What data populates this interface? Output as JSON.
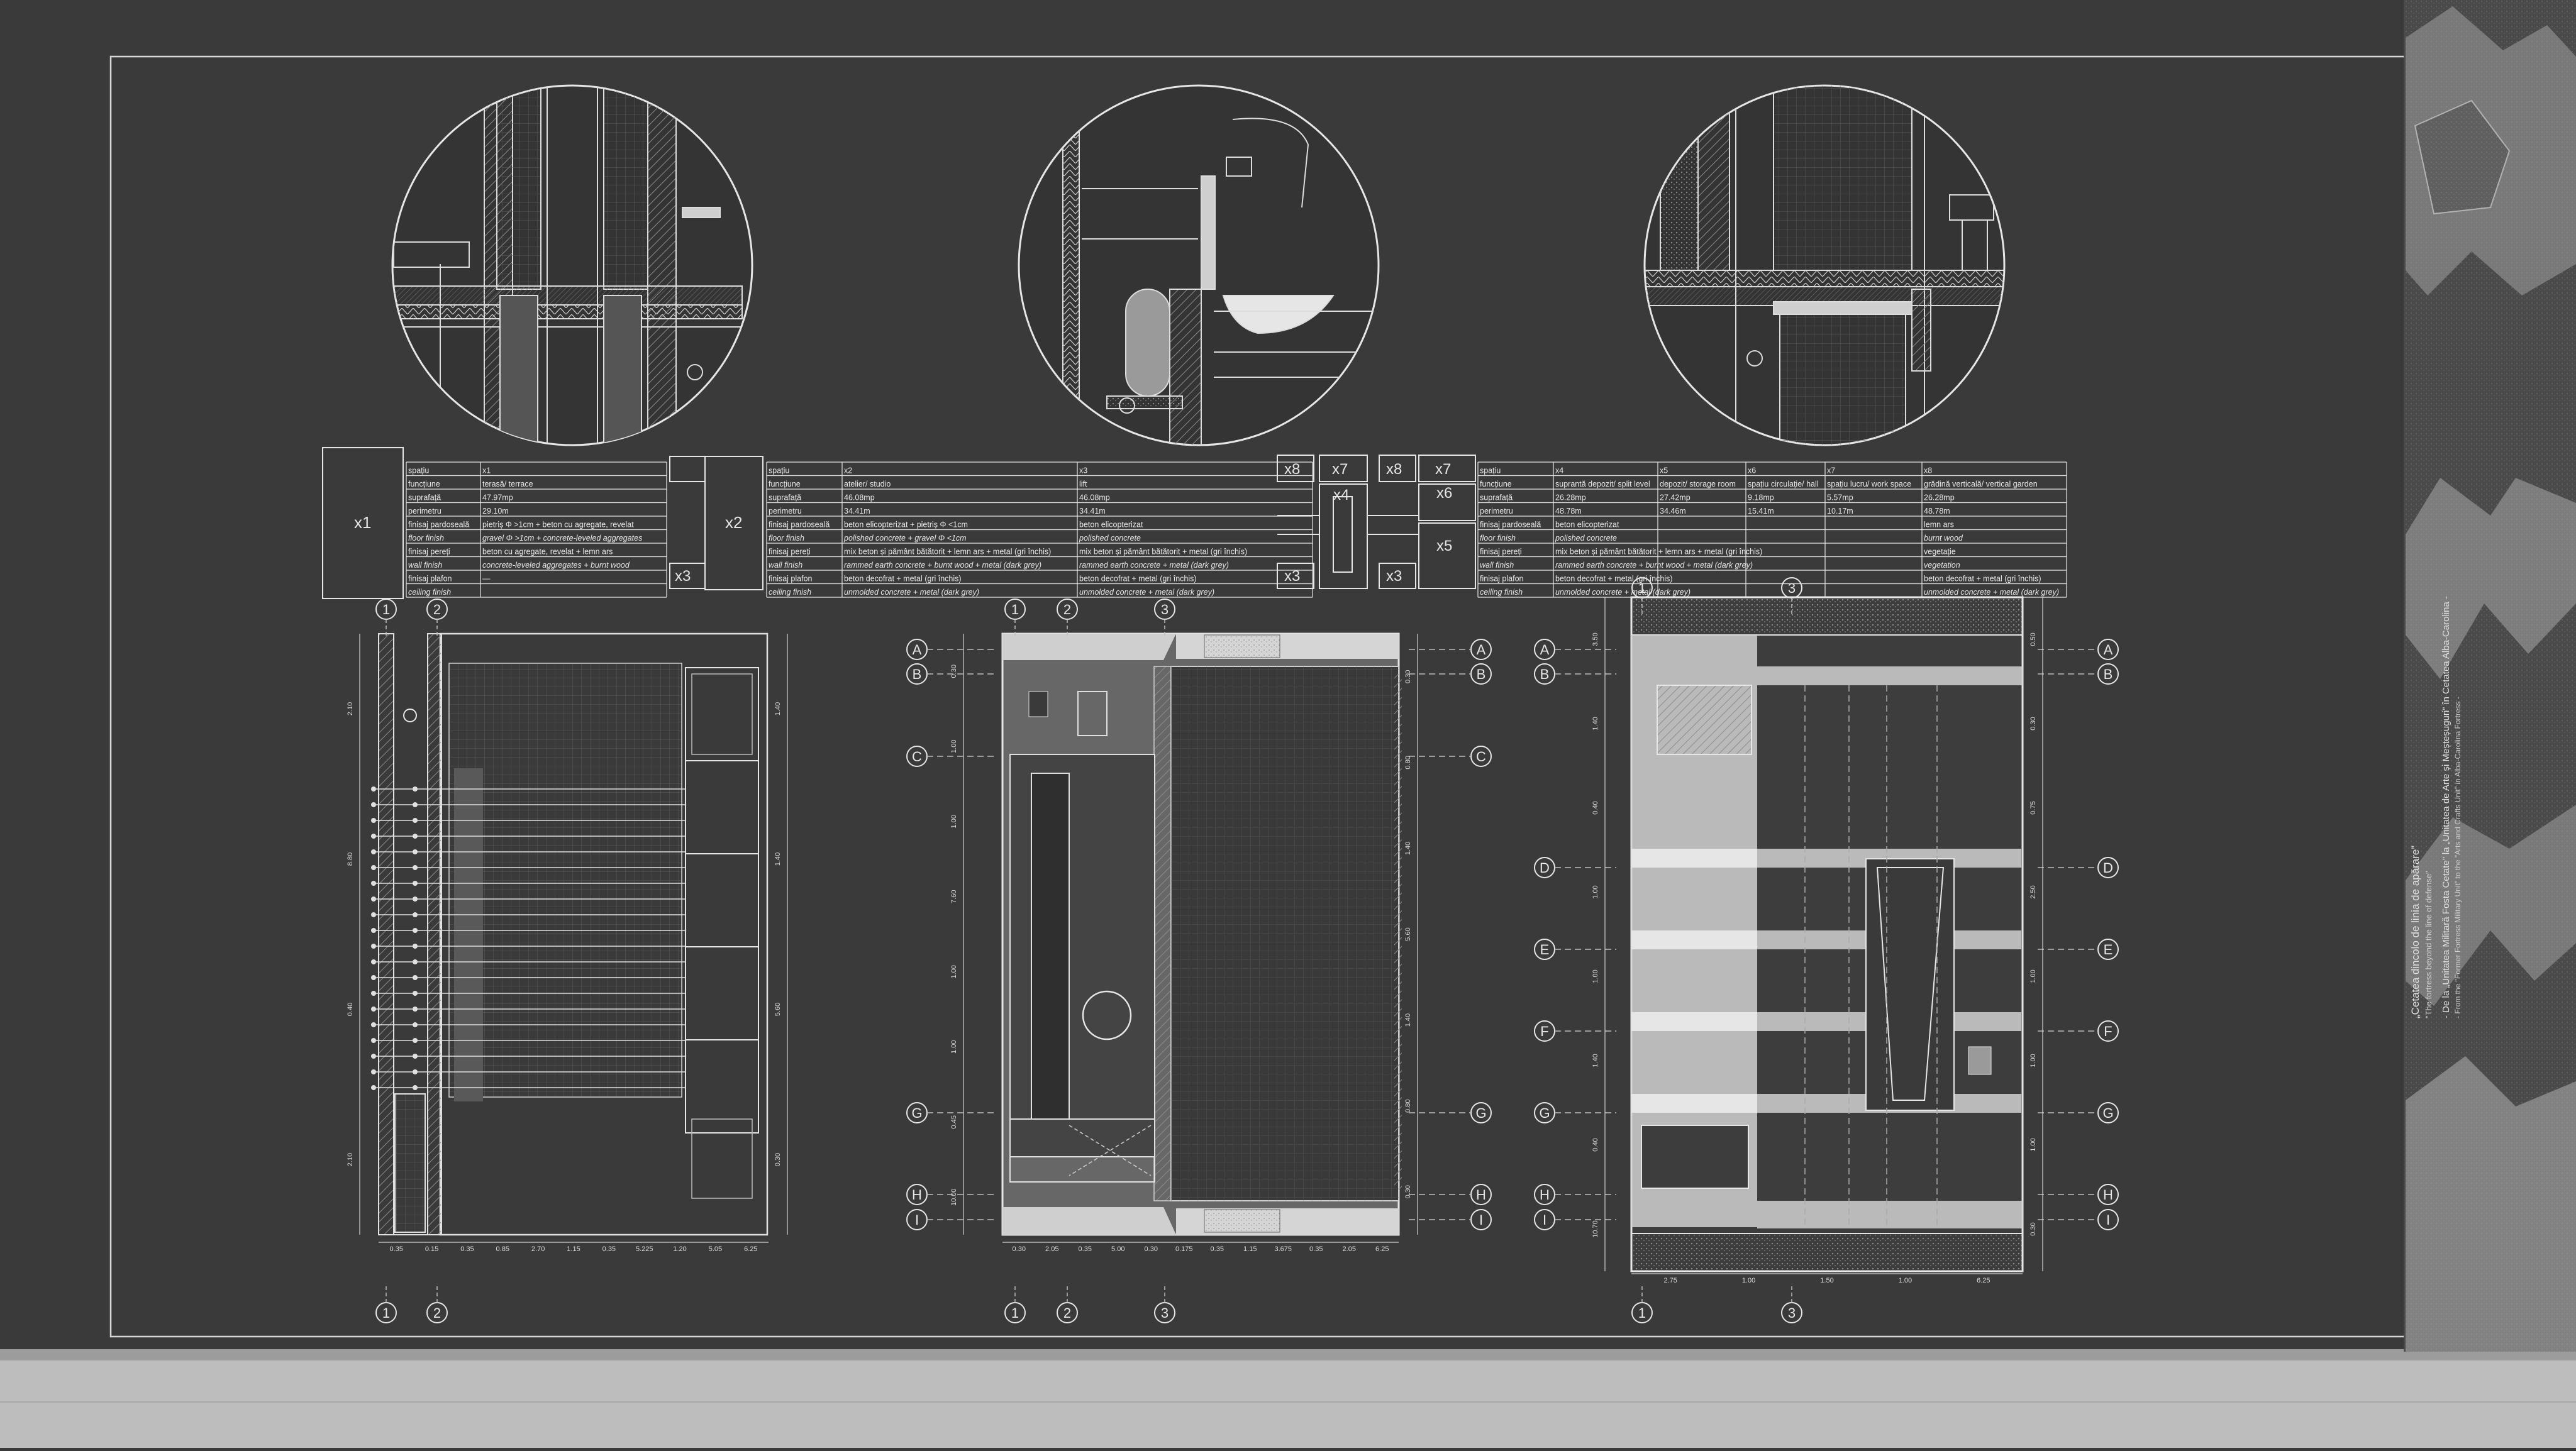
{
  "colors": {
    "background": "#3a3a3a",
    "line": "#e6e6e6",
    "hatch": "#8c8c8c",
    "floor": "#bdbdbd",
    "wall": "#cfcfcf"
  },
  "tables": {
    "left": {
      "label_a": "x1",
      "label_b": "x2",
      "label_b_small": "x3",
      "rows": [
        [
          "spațiu",
          "x1"
        ],
        [
          "funcțiune",
          "terasă/ terrace"
        ],
        [
          "suprafață",
          "47.97mp"
        ],
        [
          "perimetru",
          "29.10m"
        ],
        [
          "finisaj pardoseală",
          "pietriș Φ >1cm + beton cu agregate, revelat"
        ],
        [
          "floor finish",
          "gravel Φ >1cm + concrete-leveled aggregates"
        ],
        [
          "finisaj pereți",
          "beton cu agregate, revelat + lemn ars"
        ],
        [
          "wall finish",
          "concrete-leveled aggregates + burnt wood"
        ],
        [
          "finisaj plafon",
          "—"
        ],
        [
          "ceiling finish",
          ""
        ]
      ]
    },
    "middle": {
      "rows": [
        [
          "spațiu",
          "x2",
          "x3"
        ],
        [
          "funcțiune",
          "atelier/ studio",
          "lift"
        ],
        [
          "suprafață",
          "46.08mp",
          "46.08mp"
        ],
        [
          "perimetru",
          "34.41m",
          "34.41m"
        ],
        [
          "finisaj pardoseală",
          "beton elicopterizat + pietriș Φ <1cm",
          "beton elicopterizat"
        ],
        [
          "floor finish",
          "polished concrete + gravel Φ <1cm",
          "polished concrete"
        ],
        [
          "finisaj pereți",
          "mix beton și pământ bătătorit + lemn ars + metal (gri închis)",
          "mix beton și pământ bătătorit + metal (gri închis)"
        ],
        [
          "wall finish",
          "rammed earth concrete + burnt wood + metal (dark grey)",
          "rammed earth concrete + metal (dark grey)"
        ],
        [
          "finisaj plafon",
          "beton decofrat + metal (gri închis)",
          "beton decofrat + metal (gri închis)"
        ],
        [
          "ceiling finish",
          "unmolded concrete + metal (dark grey)",
          "unmolded concrete + metal (dark grey)"
        ]
      ]
    },
    "key": [
      "x8",
      "x7",
      "x8",
      "x7",
      "x4",
      "x6",
      "x5",
      "x3",
      "x3"
    ],
    "right": {
      "rows": [
        [
          "spațiu",
          "x4",
          "x5",
          "x6",
          "x7",
          "x8"
        ],
        [
          "funcțiune",
          "suprantă depozit/ split level",
          "depozit/ storage room",
          "spațiu circulație/ hall",
          "spațiu lucru/ work space",
          "grădină verticală/ vertical garden"
        ],
        [
          "suprafață",
          "26.28mp",
          "27.42mp",
          "9.18mp",
          "5.57mp",
          "26.28mp"
        ],
        [
          "perimetru",
          "48.78m",
          "34.46m",
          "15.41m",
          "10.17m",
          "48.78m"
        ],
        [
          "finisaj pardoseală",
          "beton elicopterizat",
          "",
          "",
          "",
          "lemn ars"
        ],
        [
          "floor finish",
          "polished concrete",
          "",
          "",
          "",
          "burnt wood"
        ],
        [
          "finisaj pereți",
          "mix beton și pământ bătătorit + lemn ars + metal (gri închis)",
          "",
          "",
          "",
          "vegetație"
        ],
        [
          "wall finish",
          "rammed earth concrete + burnt wood + metal (dark grey)",
          "",
          "",
          "",
          "vegetation"
        ],
        [
          "finisaj plafon",
          "beton decofrat + metal (gri închis)",
          "",
          "",
          "",
          "beton decofrat + metal (gri închis)"
        ],
        [
          "ceiling finish",
          "unmolded concrete + metal (dark grey)",
          "",
          "",
          "",
          "unmolded concrete + metal (dark grey)"
        ]
      ]
    }
  },
  "plans": {
    "left": {
      "axes_top": [
        "1",
        "2"
      ],
      "axes_bottom": [
        "1",
        "2"
      ],
      "dims_bottom": [
        "0.35",
        "0.15",
        "0.35",
        "0.85",
        "2.70",
        "1.15",
        "0.35",
        "5.225",
        "1.20",
        "5.05",
        "6.25"
      ],
      "dims_left": [
        "2.10",
        "8.80",
        "0.40",
        "2.10"
      ],
      "dims_right": [
        "1.40",
        "1.40",
        "5.60",
        "0.30"
      ]
    },
    "middle": {
      "axes_top": [
        "1",
        "2",
        "3"
      ],
      "axes_bottom": [
        "1",
        "2",
        "3"
      ],
      "axes_rows": [
        "A",
        "B",
        "C",
        "G",
        "H",
        "I"
      ],
      "dims_bottom": [
        "0.30",
        "2.05",
        "0.35",
        "5.00",
        "0.30",
        "0.175",
        "0.35",
        "1.15",
        "3.675",
        "0.35",
        "2.05",
        "6.25"
      ],
      "dims_left": [
        "0.30",
        "1.00",
        "1.00",
        "7.60",
        "1.00",
        "1.00",
        "0.45",
        "10.00"
      ],
      "dims_right": [
        "0.30",
        "0.80",
        "1.40",
        "5.60",
        "1.40",
        "0.80",
        "0.30"
      ]
    },
    "right": {
      "axes_top": [
        "1",
        "3"
      ],
      "axes_bottom": [
        "1",
        "3"
      ],
      "axes_rows": [
        "A",
        "B",
        "D",
        "E",
        "F",
        "G",
        "H",
        "I"
      ],
      "dims_bottom": [
        "2.75",
        "1.00",
        "1.50",
        "1.00",
        "6.25"
      ],
      "dims_left": [
        "3.50",
        "1.40",
        "0.40",
        "1.00",
        "1.00",
        "1.40",
        "0.40",
        "10.70"
      ],
      "dims_right": [
        "0.50",
        "0.30",
        "0.75",
        "2.50",
        "1.00",
        "1.00",
        "1.00",
        "0.30"
      ]
    }
  },
  "side_text": [
    "„Cetatea dincolo de linia de apărare”",
    "\"The fortress beyond the line of defense\"",
    "- De la „Unitatea Militară Fosta Cetate” la „Unitatea de Arte și Meșteșuguri” în Cetatea Alba-Carolina -",
    "- From the \"Former Fortress Military Unit\" to the \"Arts and Crafts Unit\" in Alba-Carolina Fortress -"
  ]
}
